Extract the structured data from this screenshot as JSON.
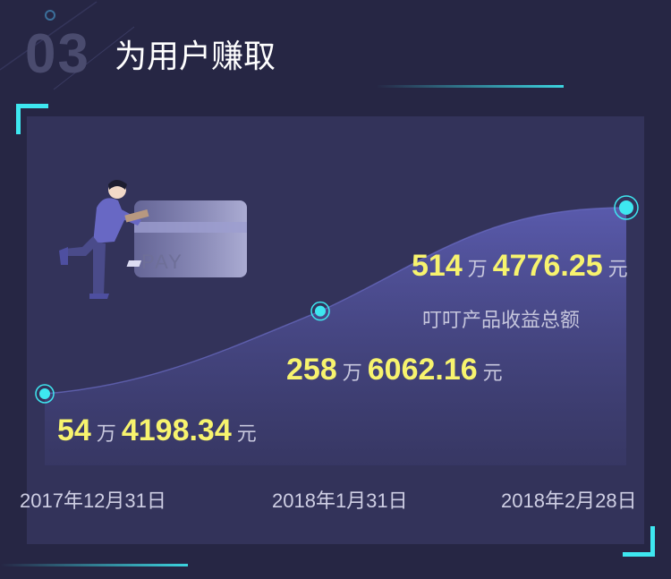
{
  "header": {
    "number": "03",
    "title": "为用户赚取"
  },
  "colors": {
    "background": "#262644",
    "panel": "#33335a",
    "accent": "#3ee7f0",
    "amount": "#f7f36e"
  },
  "illustration": {
    "card_text": "PAY",
    "icon_name": "person-with-payment-card-illustration"
  },
  "chart_data": {
    "type": "area",
    "x": [
      "2017年12月31日",
      "2018年1月31日",
      "2018年2月28日"
    ],
    "series": [
      {
        "values": [
          544198.34,
          2586062.16,
          5144776.25
        ]
      }
    ],
    "point_labels": [
      {
        "wan": "54",
        "unit": "万",
        "rest": "4198.34",
        "yuan": "元"
      },
      {
        "wan": "258",
        "unit": "万",
        "rest": "6062.16",
        "yuan": "元"
      },
      {
        "wan": "514",
        "unit": "万",
        "rest": "4776.25",
        "yuan": "元"
      }
    ],
    "annotation": "叮叮产品收益总额"
  }
}
